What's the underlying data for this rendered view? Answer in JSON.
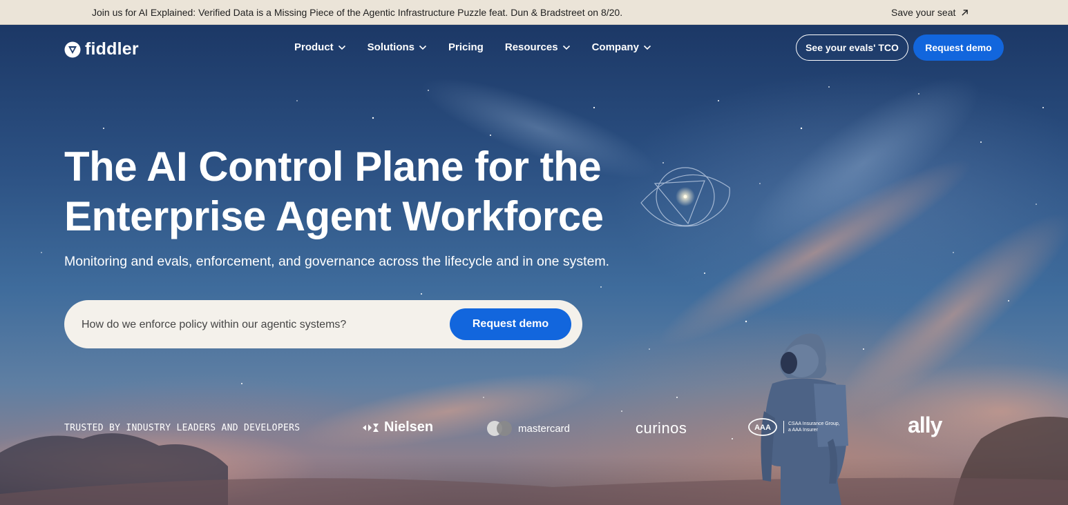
{
  "announcement": {
    "message": "Join us for AI Explained: Verified Data is a Missing Piece of the Agentic Infrastructure Puzzle feat. Dun & Bradstreet on 8/20.",
    "cta_label": "Save your seat",
    "cta_icon": "arrow-up-right-icon"
  },
  "nav": {
    "logo_text": "fiddler",
    "logo_icon": "fiddler-shield-icon",
    "links": [
      {
        "label": "Product",
        "has_dropdown": true
      },
      {
        "label": "Solutions",
        "has_dropdown": true
      },
      {
        "label": "Pricing",
        "has_dropdown": false
      },
      {
        "label": "Resources",
        "has_dropdown": true
      },
      {
        "label": "Company",
        "has_dropdown": true
      }
    ],
    "secondary_button": "See your evals' TCO",
    "primary_button": "Request demo"
  },
  "hero": {
    "headline_line1": "The AI Control Plane for the",
    "headline_line2": "Enterprise Agent Workforce",
    "subheadline": "Monitoring and evals, enforcement, and governance across the lifecycle and in one system.",
    "prompt_placeholder": "How do we enforce policy within our agentic systems?",
    "prompt_button": "Request demo"
  },
  "trusted": {
    "label": "TRUSTED BY INDUSTRY LEADERS AND DEVELOPERS",
    "logos": [
      {
        "name": "Nielsen",
        "text": "Nielsen"
      },
      {
        "name": "Mastercard",
        "text": "mastercard"
      },
      {
        "name": "Curinos",
        "text": "curinos"
      },
      {
        "name": "AAA",
        "text_line1": "CSAA Insurance Group,",
        "text_line2": "a AAA Insurer"
      },
      {
        "name": "Ally",
        "text": "ally"
      }
    ]
  },
  "colors": {
    "accent": "#1266dd",
    "announcement_bg": "#ebe4d8",
    "prompt_bg": "#f4f1eb"
  }
}
